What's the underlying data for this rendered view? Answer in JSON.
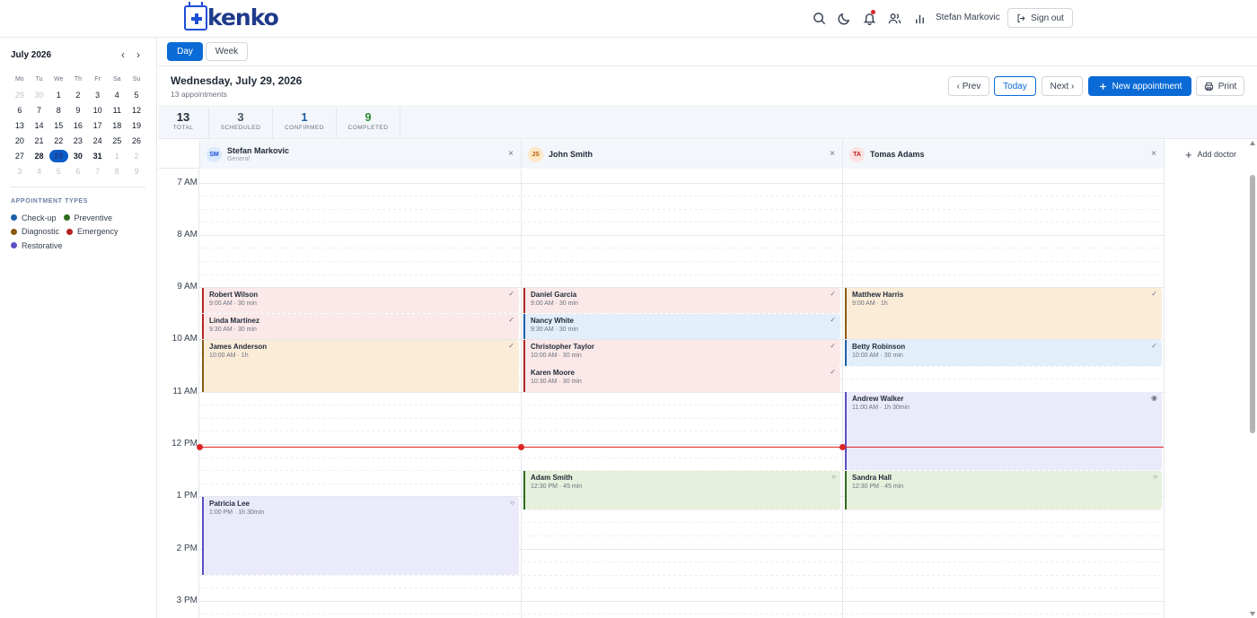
{
  "app": {
    "brand": "kenko"
  },
  "header": {
    "user_name": "Stefan Markovic",
    "signout_label": "Sign out"
  },
  "mini_calendar": {
    "month_label": "July 2026",
    "prev_symbol": "‹",
    "next_symbol": "›",
    "weekdays": [
      "Mo",
      "Tu",
      "We",
      "Th",
      "Fr",
      "Sa",
      "Su"
    ],
    "weeks": [
      [
        "29",
        "30",
        "1",
        "2",
        "3",
        "4",
        "5"
      ],
      [
        "6",
        "7",
        "8",
        "9",
        "10",
        "11",
        "12"
      ],
      [
        "13",
        "14",
        "15",
        "16",
        "17",
        "18",
        "19"
      ],
      [
        "20",
        "21",
        "22",
        "23",
        "24",
        "25",
        "26"
      ],
      [
        "27",
        "28",
        "29",
        "30",
        "31",
        "1",
        "2"
      ],
      [
        "3",
        "4",
        "5",
        "6",
        "7",
        "8",
        "9"
      ]
    ],
    "selected_day": "29"
  },
  "appointment_types": {
    "title": "APPOINTMENT TYPES",
    "items": [
      {
        "label": "Check-up",
        "color": "#1d5fa8"
      },
      {
        "label": "Preventive",
        "color": "#2e6b1f"
      },
      {
        "label": "Diagnostic",
        "color": "#8a5a13"
      },
      {
        "label": "Emergency",
        "color": "#b42323"
      },
      {
        "label": "Restorative",
        "color": "#5b4fc4"
      }
    ]
  },
  "views": {
    "day_label": "Day",
    "week_label": "Week",
    "active": "Day"
  },
  "day_header": {
    "date": "Wednesday, July 29, 2026",
    "count_text": "13 appointments",
    "prev_label": "‹ Prev",
    "today_label": "Today",
    "next_label": "Next ›",
    "new_label": "New appointment",
    "print_label": "Print"
  },
  "stats": [
    {
      "value": "13",
      "label": "TOTAL",
      "color": "#1f2937"
    },
    {
      "value": "3",
      "label": "SCHEDULED",
      "color": "#4b5563"
    },
    {
      "value": "1",
      "label": "CONFIRMED",
      "color": "#1d5fa8"
    },
    {
      "value": "9",
      "label": "COMPLETED",
      "color": "#2e8b3a"
    }
  ],
  "doctors": [
    {
      "initials": "SM",
      "name": "Stefan Markovic",
      "specialty": "General",
      "avatar_bg": "#dbeafe",
      "avatar_fg": "#1d4ed8"
    },
    {
      "initials": "JS",
      "name": "John Smith",
      "specialty": "",
      "avatar_bg": "#fde7c7",
      "avatar_fg": "#b45309"
    },
    {
      "initials": "TA",
      "name": "Tomas Adams",
      "specialty": "",
      "avatar_bg": "#fde2e2",
      "avatar_fg": "#b91c1c"
    }
  ],
  "add_doctor_label": "Add doctor",
  "hours": [
    "7 AM",
    "8 AM",
    "9 AM",
    "10 AM",
    "11 AM",
    "12 PM",
    "1 PM",
    "2 PM",
    "3 PM"
  ],
  "current_time": "12:03 PM",
  "appointments": [
    {
      "doctor": 0,
      "name": "Robert Wilson",
      "time_label": "9:00 AM · 30 min",
      "start": "9:00",
      "duration_min": 30,
      "type": "Emergency",
      "status": "✓"
    },
    {
      "doctor": 0,
      "name": "Linda Martinez",
      "time_label": "9:30 AM · 30 min",
      "start": "9:30",
      "duration_min": 30,
      "type": "Emergency",
      "status": "✓"
    },
    {
      "doctor": 0,
      "name": "James Anderson",
      "time_label": "10:00 AM · 1h",
      "start": "10:00",
      "duration_min": 60,
      "type": "Diagnostic",
      "status": "✓"
    },
    {
      "doctor": 0,
      "name": "Patricia Lee",
      "time_label": "1:00 PM · 1h 30min",
      "start": "13:00",
      "duration_min": 90,
      "type": "Restorative",
      "status": "○"
    },
    {
      "doctor": 1,
      "name": "Daniel Garcia",
      "time_label": "9:00 AM · 30 min",
      "start": "9:00",
      "duration_min": 30,
      "type": "Emergency",
      "status": "✓"
    },
    {
      "doctor": 1,
      "name": "Nancy White",
      "time_label": "9:30 AM · 30 min",
      "start": "9:30",
      "duration_min": 30,
      "type": "Check-up",
      "status": "✓"
    },
    {
      "doctor": 1,
      "name": "Christopher Taylor",
      "time_label": "10:00 AM · 30 min",
      "start": "10:00",
      "duration_min": 30,
      "type": "Emergency",
      "status": "✓"
    },
    {
      "doctor": 1,
      "name": "Karen Moore",
      "time_label": "10:30 AM · 30 min",
      "start": "10:30",
      "duration_min": 30,
      "type": "Emergency",
      "status": "✓"
    },
    {
      "doctor": 1,
      "name": "Adam Smith",
      "time_label": "12:30 PM · 45 min",
      "start": "12:30",
      "duration_min": 45,
      "type": "Preventive",
      "status": "○"
    },
    {
      "doctor": 2,
      "name": "Matthew Harris",
      "time_label": "9:00 AM · 1h",
      "start": "9:00",
      "duration_min": 60,
      "type": "Diagnostic",
      "status": "✓"
    },
    {
      "doctor": 2,
      "name": "Betty Robinson",
      "time_label": "10:00 AM · 30 min",
      "start": "10:00",
      "duration_min": 30,
      "type": "Check-up",
      "status": "✓"
    },
    {
      "doctor": 2,
      "name": "Andrew Walker",
      "time_label": "11:00 AM · 1h 30min",
      "start": "11:00",
      "duration_min": 90,
      "type": "Restorative",
      "status": "◉"
    },
    {
      "doctor": 2,
      "name": "Sandra Hall",
      "time_label": "12:30 PM · 45 min",
      "start": "12:30",
      "duration_min": 45,
      "type": "Preventive",
      "status": "○"
    }
  ],
  "type_styles": {
    "Emergency": {
      "bg": "#fbe9e9",
      "border": "#b42323"
    },
    "Diagnostic": {
      "bg": "#fbecd8",
      "border": "#8a5a13"
    },
    "Check-up": {
      "bg": "#e3eefb",
      "border": "#1d5fa8"
    },
    "Preventive": {
      "bg": "#e6f0dc",
      "border": "#2e6b1f"
    },
    "Restorative": {
      "bg": "#ebeafb",
      "border": "#5b4fc4"
    }
  }
}
